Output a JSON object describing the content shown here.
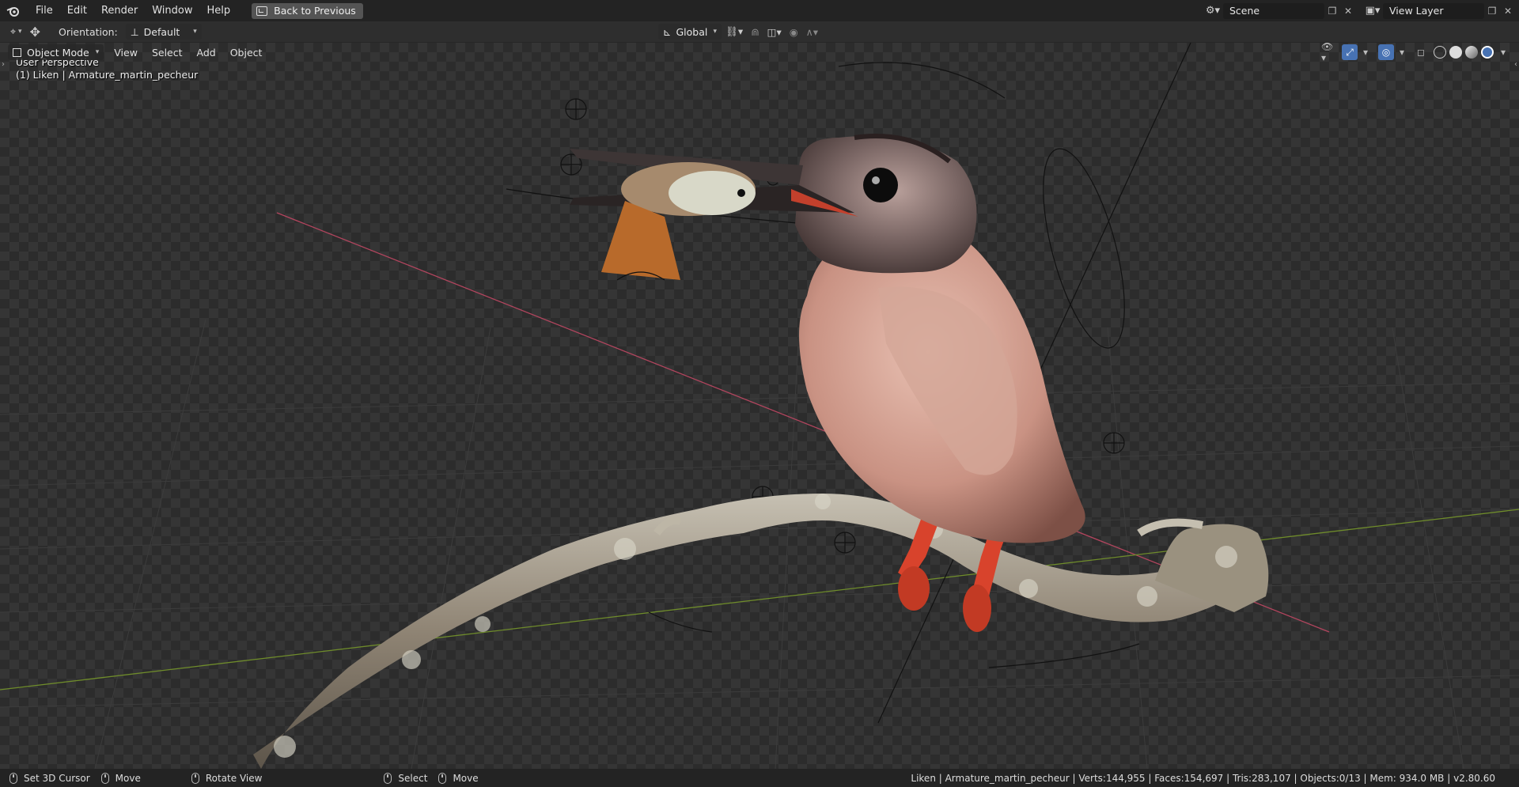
{
  "app": {
    "menu": [
      "File",
      "Edit",
      "Render",
      "Window",
      "Help"
    ],
    "back_button": "Back to Previous",
    "scene": "Scene",
    "view_layer": "View Layer"
  },
  "toolbar": {
    "orientation_label": "Orientation:",
    "orientation_value": "Default",
    "transform_space": "Global"
  },
  "viewport_header": {
    "mode": "Object Mode",
    "menus": [
      "View",
      "Select",
      "Add",
      "Object"
    ]
  },
  "viewport": {
    "perspective": "User Perspective",
    "object_info": "(1) Liken | Armature_martin_pecheur"
  },
  "statusbar": {
    "items": [
      "Set 3D Cursor",
      "Move",
      "Rotate View",
      "Select",
      "Move"
    ],
    "stats": "Liken | Armature_martin_pecheur | Verts:144,955 | Faces:154,697 | Tris:283,107 | Objects:0/13 | Mem: 934.0 MB | v2.80.60"
  },
  "colors": {
    "accent": "#4772b3",
    "x_axis": "#b2455e",
    "y_axis": "#6f8c2b"
  }
}
